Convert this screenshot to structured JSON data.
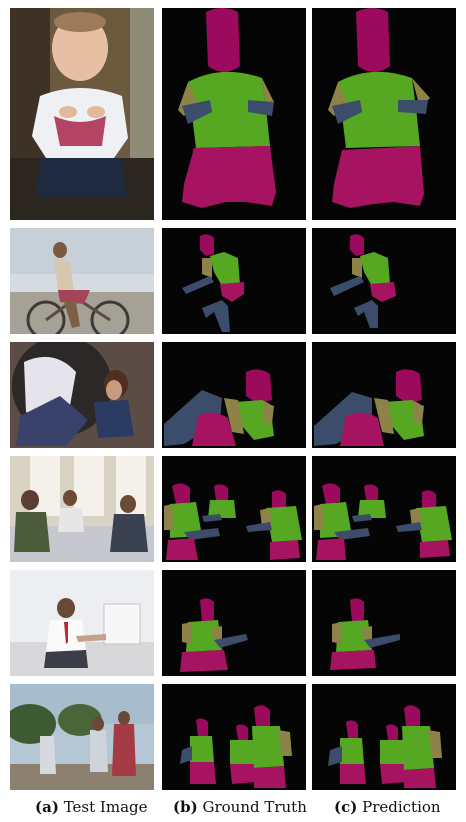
{
  "columns": [
    {
      "letter": "(a)",
      "title": "Test Image"
    },
    {
      "letter": "(b)",
      "title": "Ground Truth"
    },
    {
      "letter": "(c)",
      "title": "Prediction"
    }
  ],
  "legend_colors": {
    "background": "#050505",
    "head": "#9b0a5d",
    "torso": "#56a823",
    "upper_arm": "#8d8247",
    "lower_arm": "#3c4d6c",
    "legs": "#a61461"
  },
  "rows": [
    {
      "id": "baby",
      "content": "Baby in white shirt sitting"
    },
    {
      "id": "cyclist",
      "content": "Man riding bicycle"
    },
    {
      "id": "woman",
      "content": "Woman reclining in tube chair"
    },
    {
      "id": "meeting",
      "content": "Three men at a table"
    },
    {
      "id": "desk",
      "content": "Man at desk with computer"
    },
    {
      "id": "group",
      "content": "Cyclists standing outdoors"
    }
  ]
}
